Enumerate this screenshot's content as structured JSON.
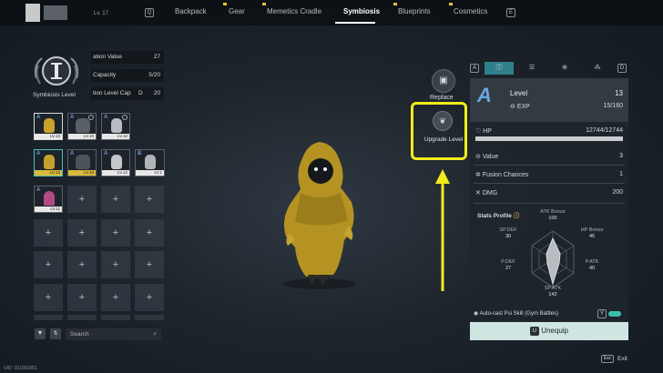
{
  "top_nav": {
    "player_level": "Lv. 17",
    "key_left": "Q",
    "key_right": "E",
    "tabs": [
      "Backpack",
      "Gear",
      "Memetics Cradle",
      "Symbiosis",
      "Blueprints",
      "Cosmetics"
    ],
    "active_tab": "Symbiosis"
  },
  "symbiosis": {
    "label": "Symbiosis Level",
    "stats": [
      {
        "label": "ation Value",
        "value": "27"
      },
      {
        "label": "Capacity",
        "value": "5/20"
      },
      {
        "label": "tion Level Cap",
        "key": "D",
        "value": "20"
      }
    ]
  },
  "deviants": [
    {
      "grade": "A",
      "level": "LV.13",
      "selected": true
    },
    {
      "grade": "A",
      "level": "LV.10"
    },
    {
      "grade": "A",
      "level": "LV.12"
    },
    {
      "grade": "A",
      "level": "LV.13",
      "gold": true
    },
    {
      "grade": "A",
      "level": "LV.10",
      "gold": true
    },
    {
      "grade": "A",
      "level": "LV.12"
    },
    {
      "grade": "B",
      "level": "LV.1"
    },
    {
      "grade": "A",
      "level": "LV.11"
    }
  ],
  "grid_empty_plus": "+",
  "search": {
    "placeholder": "Search"
  },
  "uid": "UID: 151093951",
  "actions": {
    "replace": "Replace",
    "upgrade": "Upgrade Level"
  },
  "detail": {
    "tab_keys": {
      "left": "A",
      "right": "D"
    },
    "grade": "A",
    "level_label": "Level",
    "level_value": "13",
    "exp_label": "EXP",
    "exp_value": "15/160",
    "hp_label": "HP",
    "hp_value": "12744/12744",
    "value_label": "Value",
    "value_value": "3",
    "fusion_label": "Fusion Chances",
    "fusion_value": "1",
    "dmg_label": "DMG",
    "dmg_value": "200",
    "stats_profile_label": "Stats Profile",
    "radar": {
      "atk_bonus_label": "ATK Bonus",
      "atk_bonus": "100",
      "hp_bonus_label": "HP Bonus",
      "hp_bonus": "45",
      "patk_label": "P.ATK",
      "patk": "40",
      "spatk_label": "SP.ATK",
      "spatk": "142",
      "pdef_label": "P.DEF",
      "pdef": "27",
      "spdef_label": "SP.DEF",
      "spdef": "30"
    },
    "autocast_label": "Auto-cast Psi Skill (Gym Battles)",
    "autocast_key": "Y",
    "unequip_key": "U",
    "unequip_label": "Unequip"
  },
  "footer": {
    "esc_key": "Esc",
    "exit_label": "Exit"
  },
  "colors": {
    "accent_teal": "#2f7f8b",
    "highlight_yellow": "#f2ec1c"
  }
}
